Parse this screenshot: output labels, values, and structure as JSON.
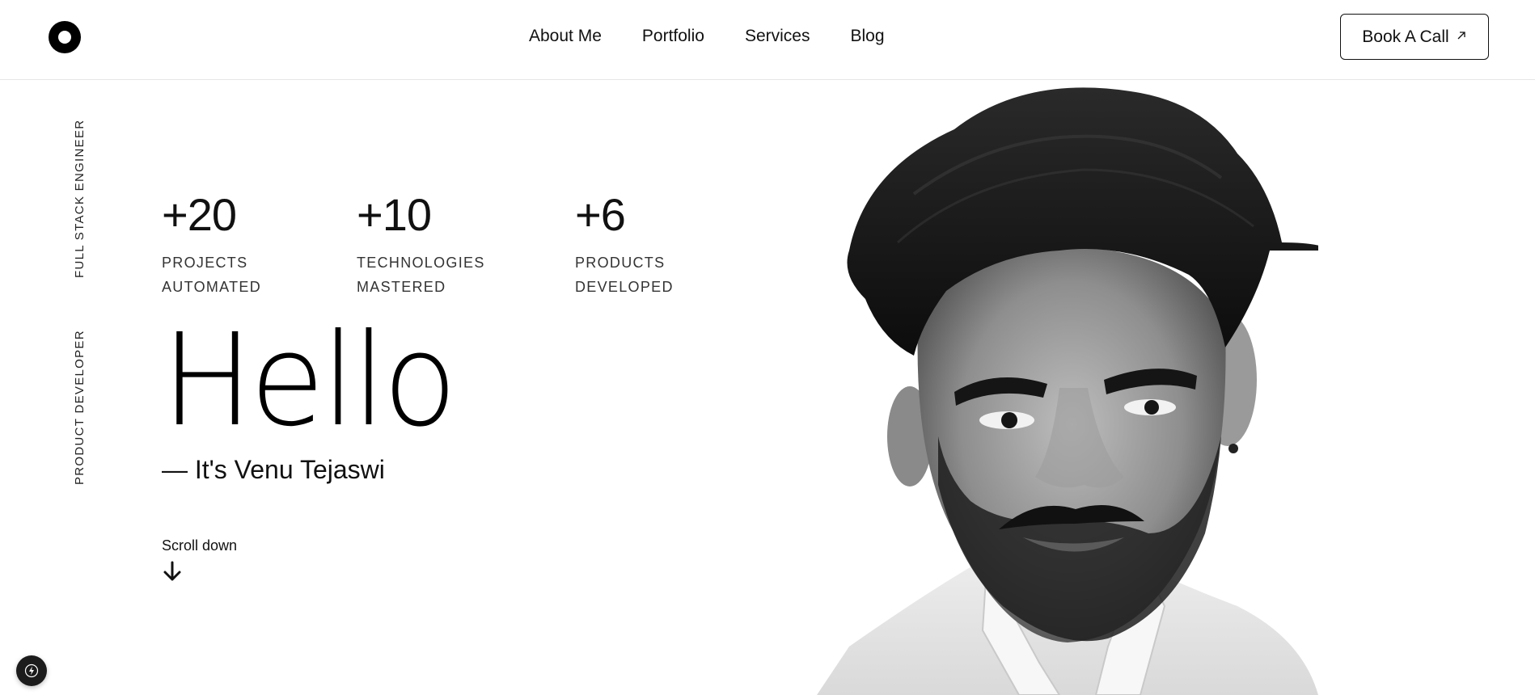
{
  "header": {
    "nav": [
      {
        "label": "About Me"
      },
      {
        "label": "Portfolio"
      },
      {
        "label": "Services"
      },
      {
        "label": "Blog"
      }
    ],
    "cta_label": "Book A Call",
    "cta_icon": "arrow-up-right-icon"
  },
  "side_labels": [
    "FULL STACK ENGINEER",
    "PRODUCT DEVELOPER"
  ],
  "stats": [
    {
      "value": "+20",
      "label_line1": "PROJECTS",
      "label_line2": "AUTOMATED"
    },
    {
      "value": "+10",
      "label_line1": "TECHNOLOGIES",
      "label_line2": "MASTERED"
    },
    {
      "value": "+6",
      "label_line1": "PRODUCTS",
      "label_line2": "DEVELOPED"
    }
  ],
  "hero": {
    "greeting": "Hello",
    "tagline": "— It's Venu Tejaswi"
  },
  "scroll": {
    "label": "Scroll down",
    "icon": "arrow-down-icon"
  },
  "badge_icon": "lightning-icon",
  "colors": {
    "text": "#111111",
    "background": "#ffffff",
    "border": "#e6e6e6",
    "badge": "#1c1c1c"
  }
}
